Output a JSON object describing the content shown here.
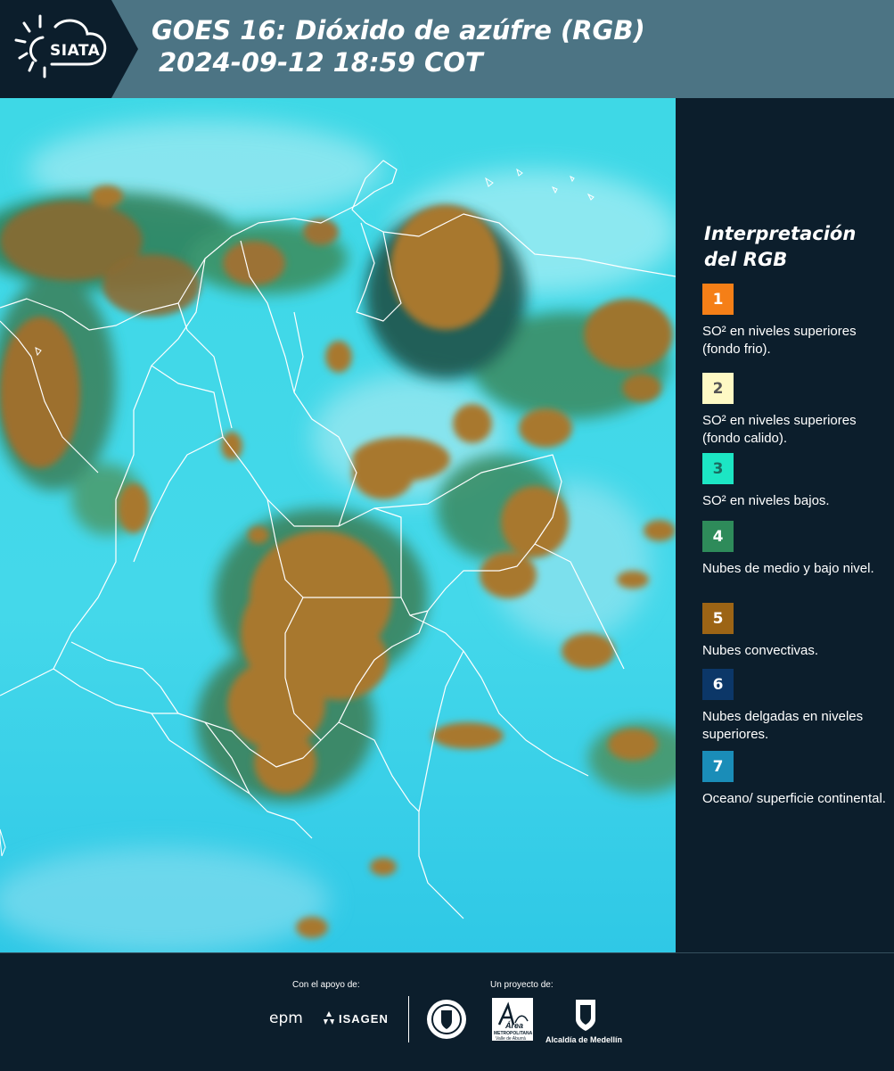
{
  "header": {
    "logo_label": "SIATA",
    "title_line1": "GOES 16: Dióxido de azúfre (RGB)",
    "title_line2": "2024-09-12 18:59 COT"
  },
  "legend": {
    "title_line1": "Interpretación",
    "title_line2": "del RGB",
    "items": [
      {
        "number": "1",
        "color": "#f57f17",
        "text_color": "#ffffff",
        "label": "SO² en niveles superiores (fondo frio)."
      },
      {
        "number": "2",
        "color": "#fef9c4",
        "text_color": "#555555",
        "label": "SO² en niveles superiores (fondo calido)."
      },
      {
        "number": "3",
        "color": "#1ce6c4",
        "text_color": "#1a6b60",
        "label": "SO² en niveles bajos."
      },
      {
        "number": "4",
        "color": "#2e8b5a",
        "text_color": "#ffffff",
        "label": "Nubes de medio y bajo nivel."
      },
      {
        "number": "5",
        "color": "#9c6415",
        "text_color": "#ffffff",
        "label": "Nubes convectivas."
      },
      {
        "number": "6",
        "color": "#0c3768",
        "text_color": "#ffffff",
        "label": "Nubes delgadas en niveles superiores."
      },
      {
        "number": "7",
        "color": "#1a8db8",
        "text_color": "#ffffff",
        "label": "Oceano/ superficie continental."
      }
    ]
  },
  "footer": {
    "support_label": "Con el apoyo de:",
    "project_label": "Un proyecto de:",
    "epm": "epm",
    "isagen": "ISAGEN",
    "area_name": "Área",
    "area_sub1": "METROPOLITANA",
    "area_sub2": "Valle de Aburrá",
    "alcaldia": "Alcaldía de Medellín"
  }
}
